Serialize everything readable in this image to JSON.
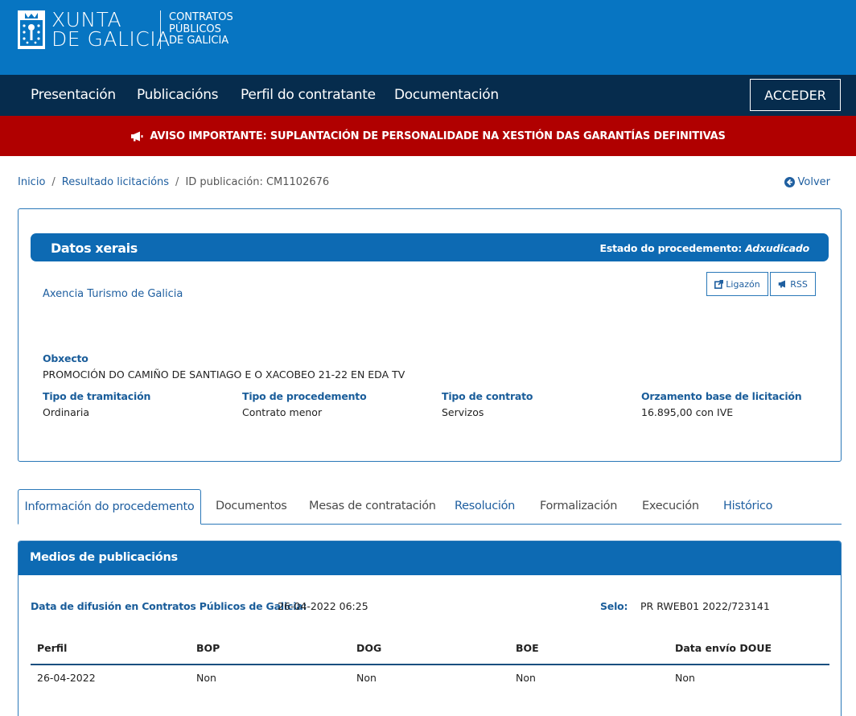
{
  "header": {
    "logo_line1": "XUNTA",
    "logo_line2": "DE GALICIA",
    "site_line1": "CONTRATOS",
    "site_line2": "PÚBLICOS",
    "site_line3": "DE GALICIA"
  },
  "nav": {
    "items": [
      {
        "label": "Presentación"
      },
      {
        "label": "Publicacións"
      },
      {
        "label": "Perfil do contratante"
      },
      {
        "label": "Documentación"
      }
    ],
    "login_label": "ACCEDER"
  },
  "alert": {
    "text": "AVISO IMPORTANTE: SUPLANTACIÓN DE PERSONALIDADE NA XESTIÓN DAS GARANTÍAS DEFINITIVAS"
  },
  "breadcrumb": {
    "items": [
      "Inicio",
      "Resultado licitacións"
    ],
    "current": "ID publicación: CM1102676",
    "back_label": "Volver"
  },
  "datos": {
    "title": "Datos xerais",
    "estado_label": "Estado do procedemento:",
    "estado_value": "Adxudicado",
    "organismo": "Axencia Turismo de Galicia",
    "ligazon_label": "Ligazón",
    "rss_label": "RSS",
    "obxecto_label": "Obxecto",
    "obxecto_value": "PROMOCIÓN DO CAMIÑO DE SANTIAGO E O XACOBEO 21-22 EN EDA TV",
    "fields": [
      {
        "label": "Tipo de tramitación",
        "value": "Ordinaria"
      },
      {
        "label": "Tipo de procedemento",
        "value": "Contrato menor"
      },
      {
        "label": "Tipo de contrato",
        "value": "Servizos"
      },
      {
        "label": "Orzamento base de licitación",
        "value": "16.895,00 con IVE"
      }
    ]
  },
  "tabs": [
    {
      "label": "Información do procedemento",
      "active": true
    },
    {
      "label": "Documentos"
    },
    {
      "label": "Mesas de contratación"
    },
    {
      "label": "Resolución"
    },
    {
      "label": "Formalización"
    },
    {
      "label": "Execución"
    },
    {
      "label": "Histórico"
    }
  ],
  "medios": {
    "title": "Medios de publicacións",
    "difusion_label": "Data de difusión en Contratos Públicos de Galicia:",
    "difusion_value": "26-04-2022 06:25",
    "selo_label": "Selo:",
    "selo_value": "PR RWEB01 2022/723141",
    "columns": [
      "Perfil",
      "BOP",
      "DOG",
      "BOE",
      "Data envío DOUE"
    ],
    "rows": [
      [
        "26-04-2022",
        "Non",
        "Non",
        "Non",
        "Non"
      ]
    ]
  },
  "colors": {
    "header_blue": "#0775c2",
    "nav_navy": "#062c4d",
    "alert_red": "#b00000",
    "accent_blue": "#0d6ab3",
    "link_blue": "#1f5fa0"
  }
}
